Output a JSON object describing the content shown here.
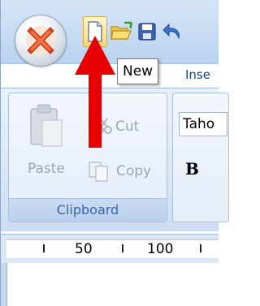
{
  "office_button": {
    "icon": "office-logo-icon"
  },
  "quick_access": {
    "buttons": [
      {
        "icon": "new-document-icon",
        "state": "hover"
      },
      {
        "icon": "open-folder-icon"
      },
      {
        "icon": "save-icon"
      },
      {
        "icon": "undo-icon"
      }
    ]
  },
  "tooltip": {
    "text": "New"
  },
  "tabs": {
    "insert_label": "Inse"
  },
  "clipboard": {
    "paste_label": "Paste",
    "cut_label": "Cut",
    "copy_label": "Copy",
    "group_label": "Clipboard"
  },
  "font": {
    "font_name": "Taho",
    "bold_label": "B"
  },
  "ruler": {
    "labels": [
      "50",
      "100"
    ]
  },
  "annotation": {
    "icon": "red-arrow-icon",
    "color": "#e60000"
  },
  "colors": {
    "ribbon_text": "#15428b",
    "group_label_text": "#3a66a8",
    "disabled_text": "#9aa6b6",
    "hover_fill": "#ffd86f"
  }
}
